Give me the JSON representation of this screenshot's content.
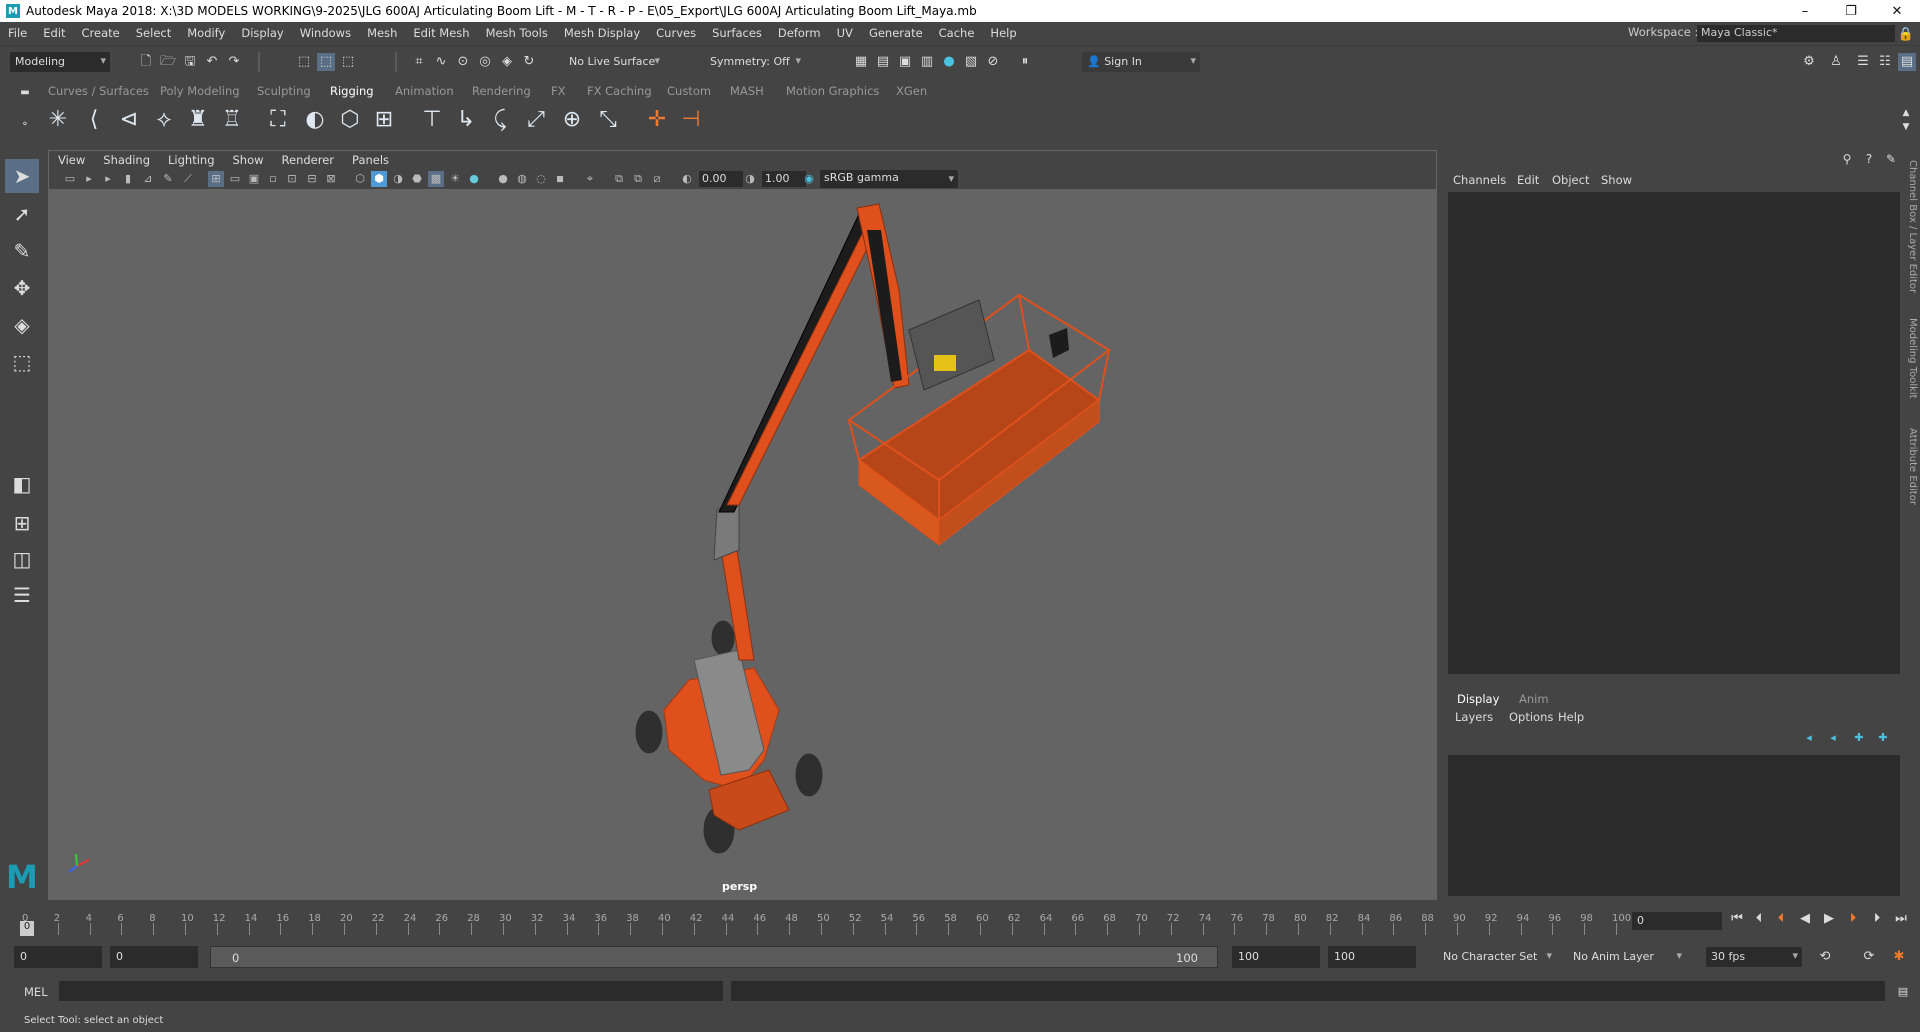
{
  "window": {
    "title": "Autodesk Maya 2018: X:\\3D MODELS WORKING\\9-2025\\JLG 600AJ Articulating Boom Lift - M - T - R - P - E\\05_Export\\JLG 600AJ Articulating Boom Lift_Maya.mb",
    "logo_letter": "M",
    "controls": [
      "–",
      "❐",
      "✕"
    ]
  },
  "menubar": [
    "File",
    "Edit",
    "Create",
    "Select",
    "Modify",
    "Display",
    "Windows",
    "Mesh",
    "Edit Mesh",
    "Mesh Tools",
    "Mesh Display",
    "Curves",
    "Surfaces",
    "Deform",
    "UV",
    "Generate",
    "Cache",
    "Help"
  ],
  "workspace": {
    "label": "Workspace :",
    "value": "Maya Classic*"
  },
  "statusline": {
    "mode": "Modeling",
    "live_surface": "No Live Surface",
    "symmetry": "Symmetry: Off",
    "sign_in": "Sign In"
  },
  "shelf": {
    "tabs": [
      "Curves / Surfaces",
      "Poly Modeling",
      "Sculpting",
      "Rigging",
      "Animation",
      "Rendering",
      "FX",
      "FX Caching",
      "Custom",
      "MASH",
      "Motion Graphics",
      "XGen"
    ],
    "active_tab": "Rigging"
  },
  "viewport": {
    "menu": [
      "View",
      "Shading",
      "Lighting",
      "Show",
      "Renderer",
      "Panels"
    ],
    "exposure": "0.00",
    "gamma": "1.00",
    "color_space": "sRGB gamma",
    "camera_label": "persp",
    "model_colors": {
      "body": "#e0501c",
      "boom": "#1c1c1c",
      "tires": "#3a3a3a"
    }
  },
  "channel_box": {
    "menu": [
      "Channels",
      "Edit",
      "Object",
      "Show"
    ],
    "side_tabs": [
      "Channel Box / Layer Editor",
      "Modeling Toolkit",
      "Attribute Editor"
    ]
  },
  "layer_editor": {
    "tabs": [
      "Display",
      "Anim"
    ],
    "menu": [
      "Layers",
      "Options",
      "Help"
    ]
  },
  "timeline": {
    "ticks": [
      "0",
      "2",
      "4",
      "6",
      "8",
      "10",
      "12",
      "14",
      "16",
      "18",
      "20",
      "22",
      "24",
      "26",
      "28",
      "30",
      "32",
      "34",
      "36",
      "38",
      "40",
      "42",
      "44",
      "46",
      "48",
      "50",
      "52",
      "54",
      "56",
      "58",
      "60",
      "62",
      "64",
      "66",
      "68",
      "70",
      "72",
      "74",
      "76",
      "78",
      "80",
      "82",
      "84",
      "86",
      "88",
      "90",
      "92",
      "94",
      "96",
      "98",
      "100"
    ],
    "current_frame": "0",
    "current_marker": "0"
  },
  "range": {
    "start": "0",
    "anim_start": "0",
    "slider_start": "0",
    "slider_end": "100",
    "anim_end": "100",
    "end": "100",
    "character_set": "No Character Set",
    "anim_layer": "No Anim Layer",
    "fps": "30 fps"
  },
  "command": {
    "lang": "MEL"
  },
  "help_line": "Select Tool: select an object"
}
